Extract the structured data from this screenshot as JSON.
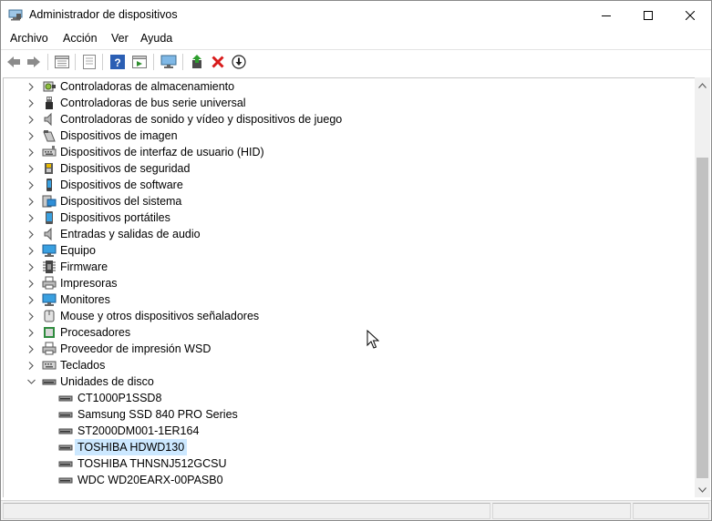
{
  "window": {
    "title": "Administrador de dispositivos"
  },
  "menu": {
    "file": "Archivo",
    "action": "Acción",
    "view": "Ver",
    "help": "Ayuda"
  },
  "toolbar": {
    "buttons": [
      "back-icon",
      "forward-icon",
      "properties-icon",
      "show-hidden-icon",
      "help-icon",
      "run-icon",
      "monitor-icon",
      "update-driver-icon",
      "uninstall-icon",
      "download-icon"
    ]
  },
  "tree": {
    "categories": [
      {
        "label": "Controladoras de almacenamiento",
        "icon": "storage-controller-icon",
        "expanded": false
      },
      {
        "label": "Controladoras de bus serie universal",
        "icon": "usb-icon",
        "expanded": false
      },
      {
        "label": "Controladoras de sonido y vídeo y dispositivos de juego",
        "icon": "speaker-icon",
        "expanded": false
      },
      {
        "label": "Dispositivos de imagen",
        "icon": "camera-icon",
        "expanded": false
      },
      {
        "label": "Dispositivos de interfaz de usuario (HID)",
        "icon": "hid-icon",
        "expanded": false
      },
      {
        "label": "Dispositivos de seguridad",
        "icon": "security-icon",
        "expanded": false
      },
      {
        "label": "Dispositivos de software",
        "icon": "software-device-icon",
        "expanded": false
      },
      {
        "label": "Dispositivos del sistema",
        "icon": "system-device-icon",
        "expanded": false
      },
      {
        "label": "Dispositivos portátiles",
        "icon": "portable-device-icon",
        "expanded": false
      },
      {
        "label": "Entradas y salidas de audio",
        "icon": "audio-io-icon",
        "expanded": false
      },
      {
        "label": "Equipo",
        "icon": "computer-icon",
        "expanded": false
      },
      {
        "label": "Firmware",
        "icon": "firmware-icon",
        "expanded": false
      },
      {
        "label": "Impresoras",
        "icon": "printer-icon",
        "expanded": false
      },
      {
        "label": "Monitores",
        "icon": "monitor-icon",
        "expanded": false
      },
      {
        "label": "Mouse y otros dispositivos señaladores",
        "icon": "mouse-icon",
        "expanded": false
      },
      {
        "label": "Procesadores",
        "icon": "processor-icon",
        "expanded": false
      },
      {
        "label": "Proveedor de impresión WSD",
        "icon": "wsd-printer-icon",
        "expanded": false
      },
      {
        "label": "Teclados",
        "icon": "keyboard-icon",
        "expanded": false
      },
      {
        "label": "Unidades de disco",
        "icon": "disk-drive-icon",
        "expanded": true
      }
    ],
    "disk_drives": [
      {
        "label": "CT1000P1SSD8",
        "selected": false
      },
      {
        "label": "Samsung SSD 840 PRO Series",
        "selected": false
      },
      {
        "label": "ST2000DM001-1ER164",
        "selected": false
      },
      {
        "label": "TOSHIBA HDWD130",
        "selected": true
      },
      {
        "label": "TOSHIBA THNSNJ512GCSU",
        "selected": false
      },
      {
        "label": "WDC WD20EARX-00PASB0",
        "selected": false
      }
    ]
  },
  "colors": {
    "selection": "#cce8ff",
    "scrollbar_thumb": "#c1c1c1",
    "scrollbar_track": "#f0f0f0"
  }
}
